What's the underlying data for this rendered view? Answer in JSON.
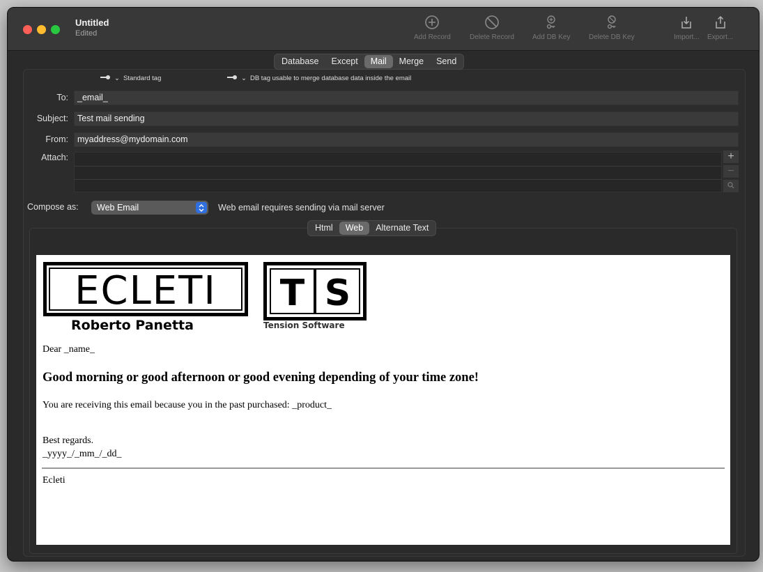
{
  "window": {
    "title": "Untitled",
    "subtitle": "Edited"
  },
  "toolbar": [
    {
      "label": "Add Record",
      "icon": "plus-circle-icon"
    },
    {
      "label": "Delete Record",
      "icon": "prohibit-icon"
    },
    {
      "label": "Add DB Key",
      "icon": "key-add-icon"
    },
    {
      "label": "Delete DB Key",
      "icon": "key-delete-icon"
    },
    {
      "label": "Import...",
      "icon": "import-icon"
    },
    {
      "label": "Export...",
      "icon": "export-icon"
    }
  ],
  "main_tabs": [
    "Database",
    "Except",
    "Mail",
    "Merge",
    "Send"
  ],
  "main_tab_active": "Mail",
  "tags": {
    "standard": "Standard tag",
    "db": "DB tag usable to merge database data inside the email"
  },
  "form": {
    "to_label": "To:",
    "to_value": "_email_",
    "subject_label": "Subject:",
    "subject_value": "Test mail sending",
    "from_label": "From:",
    "from_value": "myaddress@mydomain.com",
    "attach_label": "Attach:"
  },
  "compose": {
    "label": "Compose as:",
    "value": "Web Email",
    "note": "Web email requires sending via mail server"
  },
  "sub_tabs": [
    "Html",
    "Web",
    "Alternate Text"
  ],
  "sub_tab_active": "Web",
  "email": {
    "logo1_text": "ECLETI",
    "logo1_name": "Roberto Panetta",
    "logo2_t": "T",
    "logo2_s": "S",
    "logo2_name": "Tension Software",
    "dear": "Dear _name_",
    "headline": "Good morning or good afternoon or good evening depending of your time zone!",
    "body": "You are receiving this email because you in the past purchased: _product_",
    "regards": "Best regards.",
    "date": "_yyyy_/_mm_/_dd_",
    "signature": "Ecleti"
  }
}
